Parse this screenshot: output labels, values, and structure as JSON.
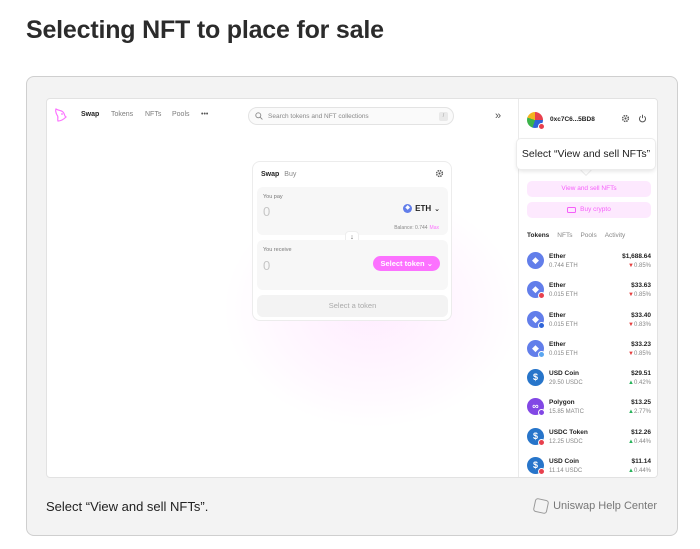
{
  "page": {
    "title": "Selecting NFT to place for sale",
    "caption": "Select “View and sell NFTs”.",
    "help_center": "Uniswap Help Center"
  },
  "nav": {
    "items": [
      "Swap",
      "Tokens",
      "NFTs",
      "Pools",
      "•••"
    ],
    "search_placeholder": "Search tokens and NFT collections",
    "search_shortcut": "/",
    "collapse_icon": "»"
  },
  "swap": {
    "tabs": [
      "Swap",
      "Buy"
    ],
    "you_pay_label": "You pay",
    "you_pay_amount": "0",
    "pay_token": "ETH",
    "balance_label": "Balance: 0.744",
    "max_label": "Max",
    "you_receive_label": "You receive",
    "you_receive_amount": "0",
    "select_token_label": "Select token ⌄",
    "bottom_button": "Select a token"
  },
  "wallet": {
    "address": "0xc7C6...5BD8",
    "tooltip": "Select “View and sell NFTs”",
    "view_sell_button": "View and sell NFTs",
    "buy_crypto_button": "Buy crypto",
    "tabs": [
      "Tokens",
      "NFTs",
      "Pools",
      "Activity"
    ],
    "tokens": [
      {
        "name": "Ether",
        "balance": "0.744 ETH",
        "price": "$1,688.64",
        "change": "0.85%",
        "direction": "down",
        "icon": "eth",
        "badge": ""
      },
      {
        "name": "Ether",
        "balance": "0.015 ETH",
        "price": "$33.63",
        "change": "0.85%",
        "direction": "down",
        "icon": "eth",
        "badge": "#e8404d"
      },
      {
        "name": "Ether",
        "balance": "0.015 ETH",
        "price": "$33.40",
        "change": "0.83%",
        "direction": "down",
        "icon": "eth",
        "badge": "#2e64d8"
      },
      {
        "name": "Ether",
        "balance": "0.015 ETH",
        "price": "$33.23",
        "change": "0.85%",
        "direction": "down",
        "icon": "eth",
        "badge": "#5aa6f0"
      },
      {
        "name": "USD Coin",
        "balance": "29.50 USDC",
        "price": "$29.51",
        "change": "0.42%",
        "direction": "up",
        "icon": "usdc",
        "badge": ""
      },
      {
        "name": "Polygon",
        "balance": "15.85 MATIC",
        "price": "$13.25",
        "change": "2.77%",
        "direction": "up",
        "icon": "matic",
        "badge": "#8247e5"
      },
      {
        "name": "USDC Token",
        "balance": "12.25 USDC",
        "price": "$12.26",
        "change": "0.44%",
        "direction": "up",
        "icon": "usdc",
        "badge": "#e8404d"
      },
      {
        "name": "USD Coin",
        "balance": "11.14 USDC",
        "price": "$11.14",
        "change": "0.44%",
        "direction": "up",
        "icon": "usdc",
        "badge": "#e8404d"
      }
    ]
  },
  "colors": {
    "accent_pink": "#fc72ff",
    "eth_blue": "#627eea",
    "usdc_blue": "#2775ca",
    "matic_purple": "#8247e5",
    "down_red": "#e53f3f",
    "up_green": "#29b35b"
  }
}
